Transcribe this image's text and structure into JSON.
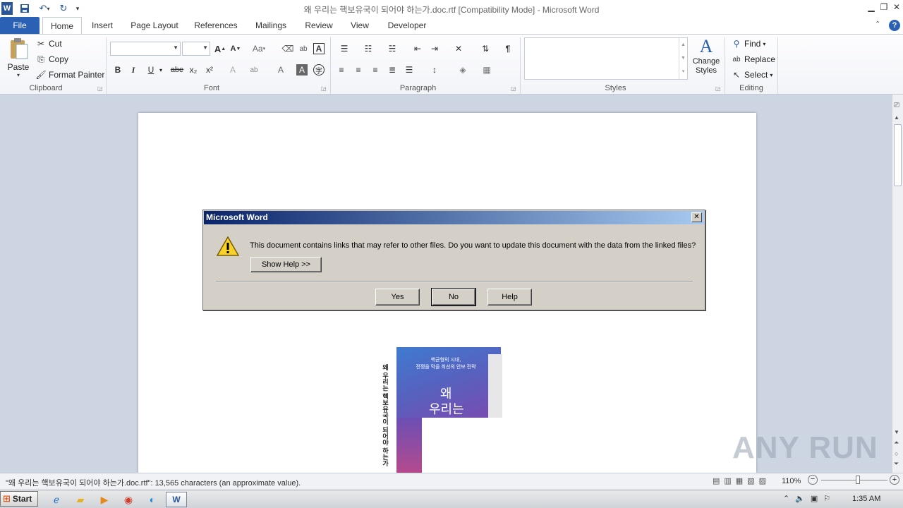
{
  "window": {
    "title": "왜 우리는 핵보유국이 되어야 하는가.doc.rtf [Compatibility Mode]  -  Microsoft Word"
  },
  "qat": {
    "word_icon": "W",
    "save_icon": "save-icon",
    "undo_icon": "undo-icon",
    "redo_icon": "redo-icon"
  },
  "tabs": [
    "File",
    "Home",
    "Insert",
    "Page Layout",
    "References",
    "Mailings",
    "Review",
    "View",
    "Developer"
  ],
  "active_tab": "Home",
  "ribbon": {
    "clipboard": {
      "paste": "Paste",
      "cut": "Cut",
      "copy": "Copy",
      "format_painter": "Format Painter",
      "label": "Clipboard"
    },
    "font": {
      "label": "Font",
      "font_name": "",
      "font_size": "",
      "bold": "B",
      "italic": "I",
      "underline": "U",
      "strike": "abe",
      "subscript": "x₂",
      "superscript": "x²",
      "grow": "A",
      "shrink": "A",
      "case": "Aa",
      "clear": "A"
    },
    "paragraph": {
      "label": "Paragraph",
      "pilcrow": "¶"
    },
    "styles": {
      "label": "Styles",
      "change_styles": "Change Styles"
    },
    "editing": {
      "label": "Editing",
      "find": "Find",
      "replace": "Replace",
      "select": "Select"
    }
  },
  "document": {
    "cover_text_line1": "핵균형의 시대,",
    "cover_text_line2": "전쟁을 막을 최선의 안보 전략",
    "cover_title1": "왜",
    "cover_title2": "우리는",
    "spine_text": "왜 우리는 핵보유국이 되어야 하는가"
  },
  "dialog": {
    "title": "Microsoft Word",
    "close": "✕",
    "message": "This document contains links that may refer to other files. Do you want to update this document with the data from the linked files?",
    "show_help": "Show Help >>",
    "yes": "Yes",
    "no": "No",
    "help": "Help"
  },
  "statusbar": {
    "text": "\"왜 우리는 핵보유국이 되어야 하는가.doc.rtf\": 13,565 characters (an approximate value).",
    "zoom": "110%",
    "zoom_level": 0.55
  },
  "watermark": "ANY RUN",
  "taskbar": {
    "start": "Start",
    "time": "1:35 AM"
  }
}
